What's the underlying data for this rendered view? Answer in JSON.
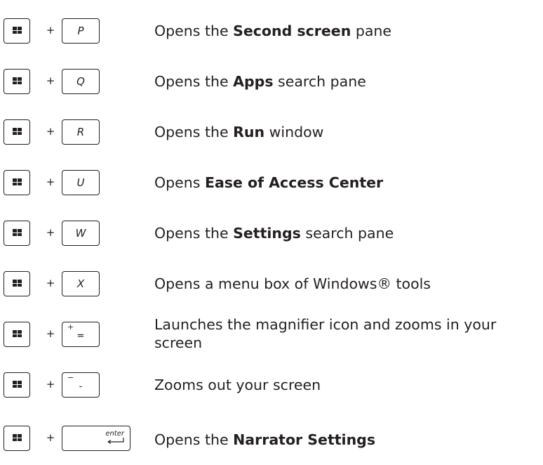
{
  "shortcuts": [
    {
      "plus": "+",
      "key": "P",
      "before": "Opens the ",
      "bold": "Second screen",
      "after": " pane"
    },
    {
      "plus": "+",
      "key": "Q",
      "before": "Opens the ",
      "bold": "Apps",
      "after": " search pane"
    },
    {
      "plus": "+",
      "key": "R",
      "before": "Opens the ",
      "bold": "Run",
      "after": " window"
    },
    {
      "plus": "+",
      "key": "U",
      "before": "Opens ",
      "bold": "Ease of Access Center",
      "after": ""
    },
    {
      "plus": "+",
      "key": "W",
      "before": "Opens the ",
      "bold": "Settings",
      "after": " search pane"
    },
    {
      "plus": "+",
      "key": "X",
      "before": "Opens a menu box of Windows® tools",
      "bold": "",
      "after": ""
    },
    {
      "plus": "+",
      "key_top": "+",
      "key_bottom": "=",
      "text_line1": "Launches the magnifier icon and zooms in your",
      "text_line2": "screen"
    },
    {
      "plus": "+",
      "key_top": "−",
      "key_bottom": "-",
      "text": "Zooms out your screen"
    },
    {
      "plus": "+",
      "key": "enter",
      "before": "Opens the ",
      "bold": "Narrator Settings",
      "after": ""
    }
  ],
  "icons": {
    "windows_key": "windows-logo-icon",
    "enter_key": "enter-arrow-icon"
  },
  "colors": {
    "text": "#231f20",
    "key_border": "#231f20"
  }
}
